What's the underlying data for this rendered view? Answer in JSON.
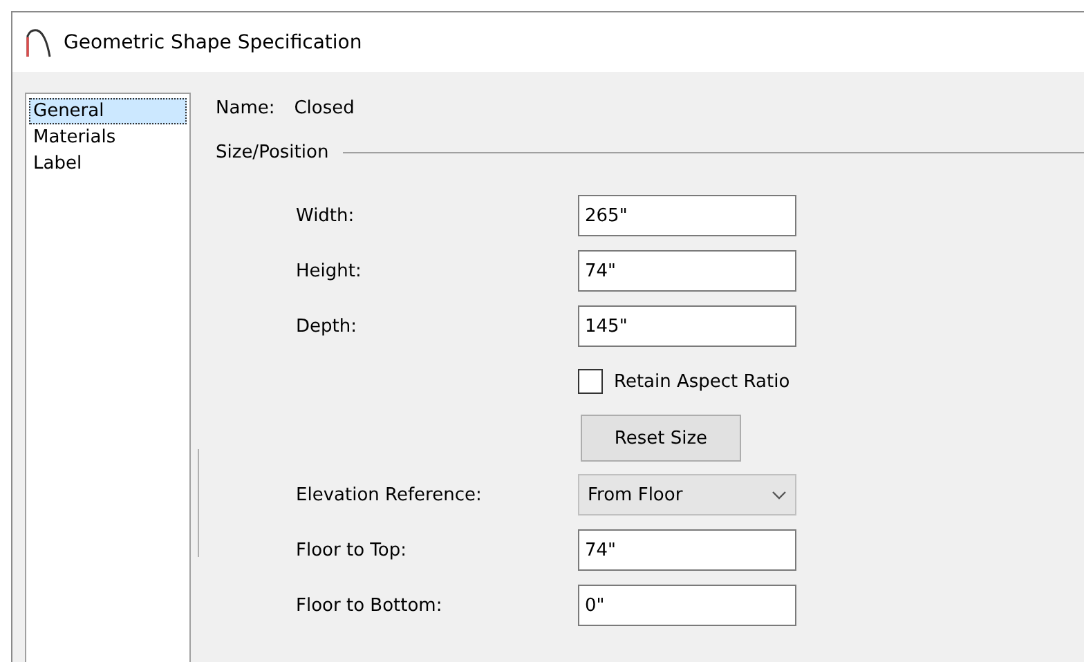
{
  "window": {
    "title": "Geometric Shape Specification"
  },
  "sidebar": {
    "items": [
      {
        "label": "General",
        "selected": true
      },
      {
        "label": "Materials",
        "selected": false
      },
      {
        "label": "Label",
        "selected": false
      }
    ]
  },
  "name": {
    "label": "Name:",
    "value": "Closed"
  },
  "section": {
    "title": "Size/Position"
  },
  "fields": [
    {
      "kind": "text",
      "label": "Width:",
      "value": "265\""
    },
    {
      "kind": "text",
      "label": "Height:",
      "value": "74\""
    },
    {
      "kind": "text",
      "label": "Depth:",
      "value": "145\""
    },
    {
      "kind": "checkbox",
      "label": "Retain Aspect Ratio",
      "checked": false
    },
    {
      "kind": "button",
      "label": "Reset Size"
    },
    {
      "kind": "dropdown",
      "label": "Elevation Reference:",
      "value": "From Floor"
    },
    {
      "kind": "text",
      "label": "Floor to Top:",
      "value": "74\""
    },
    {
      "kind": "text",
      "label": "Floor to Bottom:",
      "value": "0\""
    }
  ]
}
